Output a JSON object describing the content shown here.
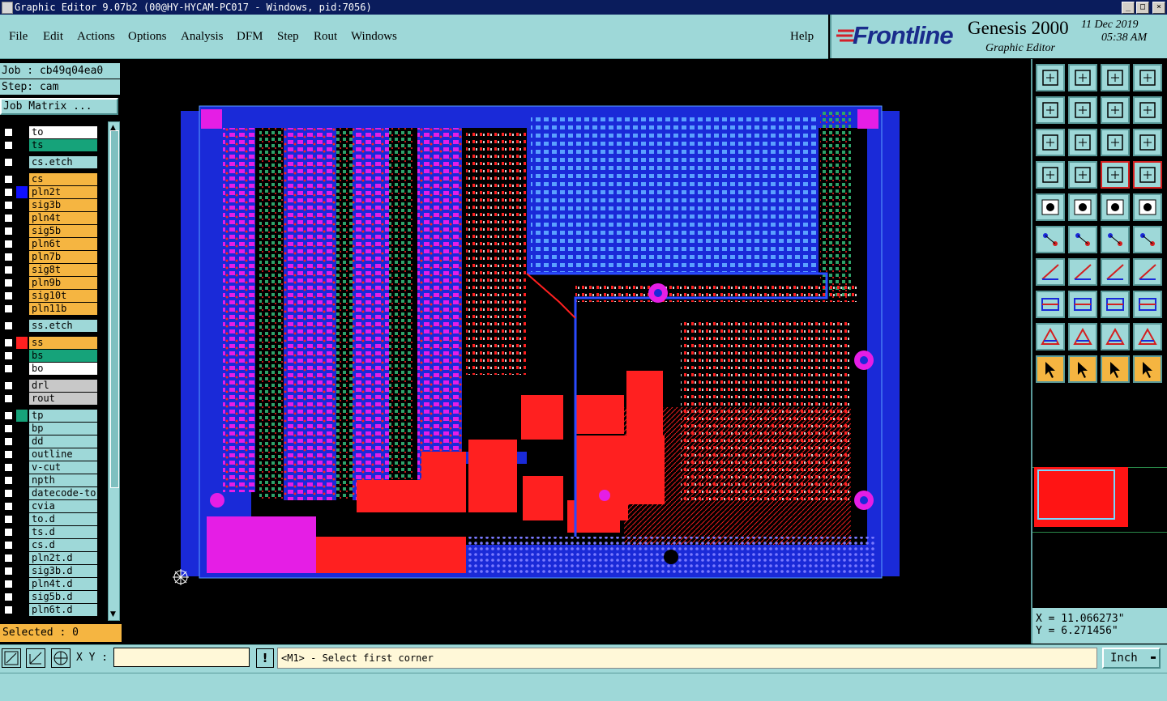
{
  "window": {
    "title": "Graphic Editor 9.07b2 (00@HY-HYCAM-PC017 - Windows, pid:7056)",
    "controls": [
      "_",
      "□",
      "×"
    ]
  },
  "menu": [
    "File",
    "Edit",
    "Actions",
    "Options",
    "Analysis",
    "DFM",
    "Step",
    "Rout",
    "Windows"
  ],
  "help": "Help",
  "brand": {
    "logo": "Frontline",
    "product": "Genesis 2000",
    "subtitle": "Graphic Editor",
    "date": "11 Dec 2019",
    "time": "05:38 AM"
  },
  "job": {
    "job_line": "Job : cb49q04ea0",
    "step_line": "Step: cam",
    "matrix_button": "Job Matrix ..."
  },
  "layers": [
    {
      "name": "to",
      "color": "#ffffff",
      "swatch": ""
    },
    {
      "name": "ts",
      "color": "#16a37a",
      "swatch": ""
    },
    {
      "name": "cs.etch",
      "color": "#9ed8d8",
      "swatch": ""
    },
    {
      "name": "cs",
      "color": "#f5b541",
      "swatch": ""
    },
    {
      "name": "pln2t",
      "color": "#f5b541",
      "swatch": "#1010ff"
    },
    {
      "name": "sig3b",
      "color": "#f5b541",
      "swatch": ""
    },
    {
      "name": "pln4t",
      "color": "#f5b541",
      "swatch": ""
    },
    {
      "name": "sig5b",
      "color": "#f5b541",
      "swatch": ""
    },
    {
      "name": "pln6t",
      "color": "#f5b541",
      "swatch": ""
    },
    {
      "name": "pln7b",
      "color": "#f5b541",
      "swatch": ""
    },
    {
      "name": "sig8t",
      "color": "#f5b541",
      "swatch": ""
    },
    {
      "name": "pln9b",
      "color": "#f5b541",
      "swatch": ""
    },
    {
      "name": "sig10t",
      "color": "#f5b541",
      "swatch": ""
    },
    {
      "name": "pln11b",
      "color": "#f5b541",
      "swatch": ""
    },
    {
      "name": "ss.etch",
      "color": "#9ed8d8",
      "swatch": ""
    },
    {
      "name": "ss",
      "color": "#f5b541",
      "swatch": "#ff2020"
    },
    {
      "name": "bs",
      "color": "#16a37a",
      "swatch": ""
    },
    {
      "name": "bo",
      "color": "#ffffff",
      "swatch": ""
    },
    {
      "name": "drl",
      "color": "#c8c8c8",
      "swatch": ""
    },
    {
      "name": "rout",
      "color": "#c8c8c8",
      "swatch": ""
    },
    {
      "name": "tp",
      "color": "#9ed8d8",
      "swatch": "#16a37a"
    },
    {
      "name": "bp",
      "color": "#9ed8d8",
      "swatch": ""
    },
    {
      "name": "dd",
      "color": "#9ed8d8",
      "swatch": ""
    },
    {
      "name": "outline",
      "color": "#9ed8d8",
      "swatch": ""
    },
    {
      "name": "v-cut",
      "color": "#9ed8d8",
      "swatch": ""
    },
    {
      "name": "npth",
      "color": "#9ed8d8",
      "swatch": ""
    },
    {
      "name": "datecode-to",
      "color": "#9ed8d8",
      "swatch": ""
    },
    {
      "name": "cvia",
      "color": "#9ed8d8",
      "swatch": ""
    },
    {
      "name": "to.d",
      "color": "#9ed8d8",
      "swatch": ""
    },
    {
      "name": "ts.d",
      "color": "#9ed8d8",
      "swatch": ""
    },
    {
      "name": "cs.d",
      "color": "#9ed8d8",
      "swatch": ""
    },
    {
      "name": "pln2t.d",
      "color": "#9ed8d8",
      "swatch": ""
    },
    {
      "name": "sig3b.d",
      "color": "#9ed8d8",
      "swatch": ""
    },
    {
      "name": "pln4t.d",
      "color": "#9ed8d8",
      "swatch": ""
    },
    {
      "name": "sig5b.d",
      "color": "#9ed8d8",
      "swatch": ""
    },
    {
      "name": "pln6t.d",
      "color": "#9ed8d8",
      "swatch": ""
    }
  ],
  "selected": "Selected : 0",
  "coords": {
    "x": "X = 11.066273\"",
    "y": "Y = 6.271456\""
  },
  "bottom": {
    "xy_label": "X Y :",
    "xy_value": "",
    "excl": "!",
    "prompt": "<M1> - Select first corner",
    "units": "Inch"
  }
}
